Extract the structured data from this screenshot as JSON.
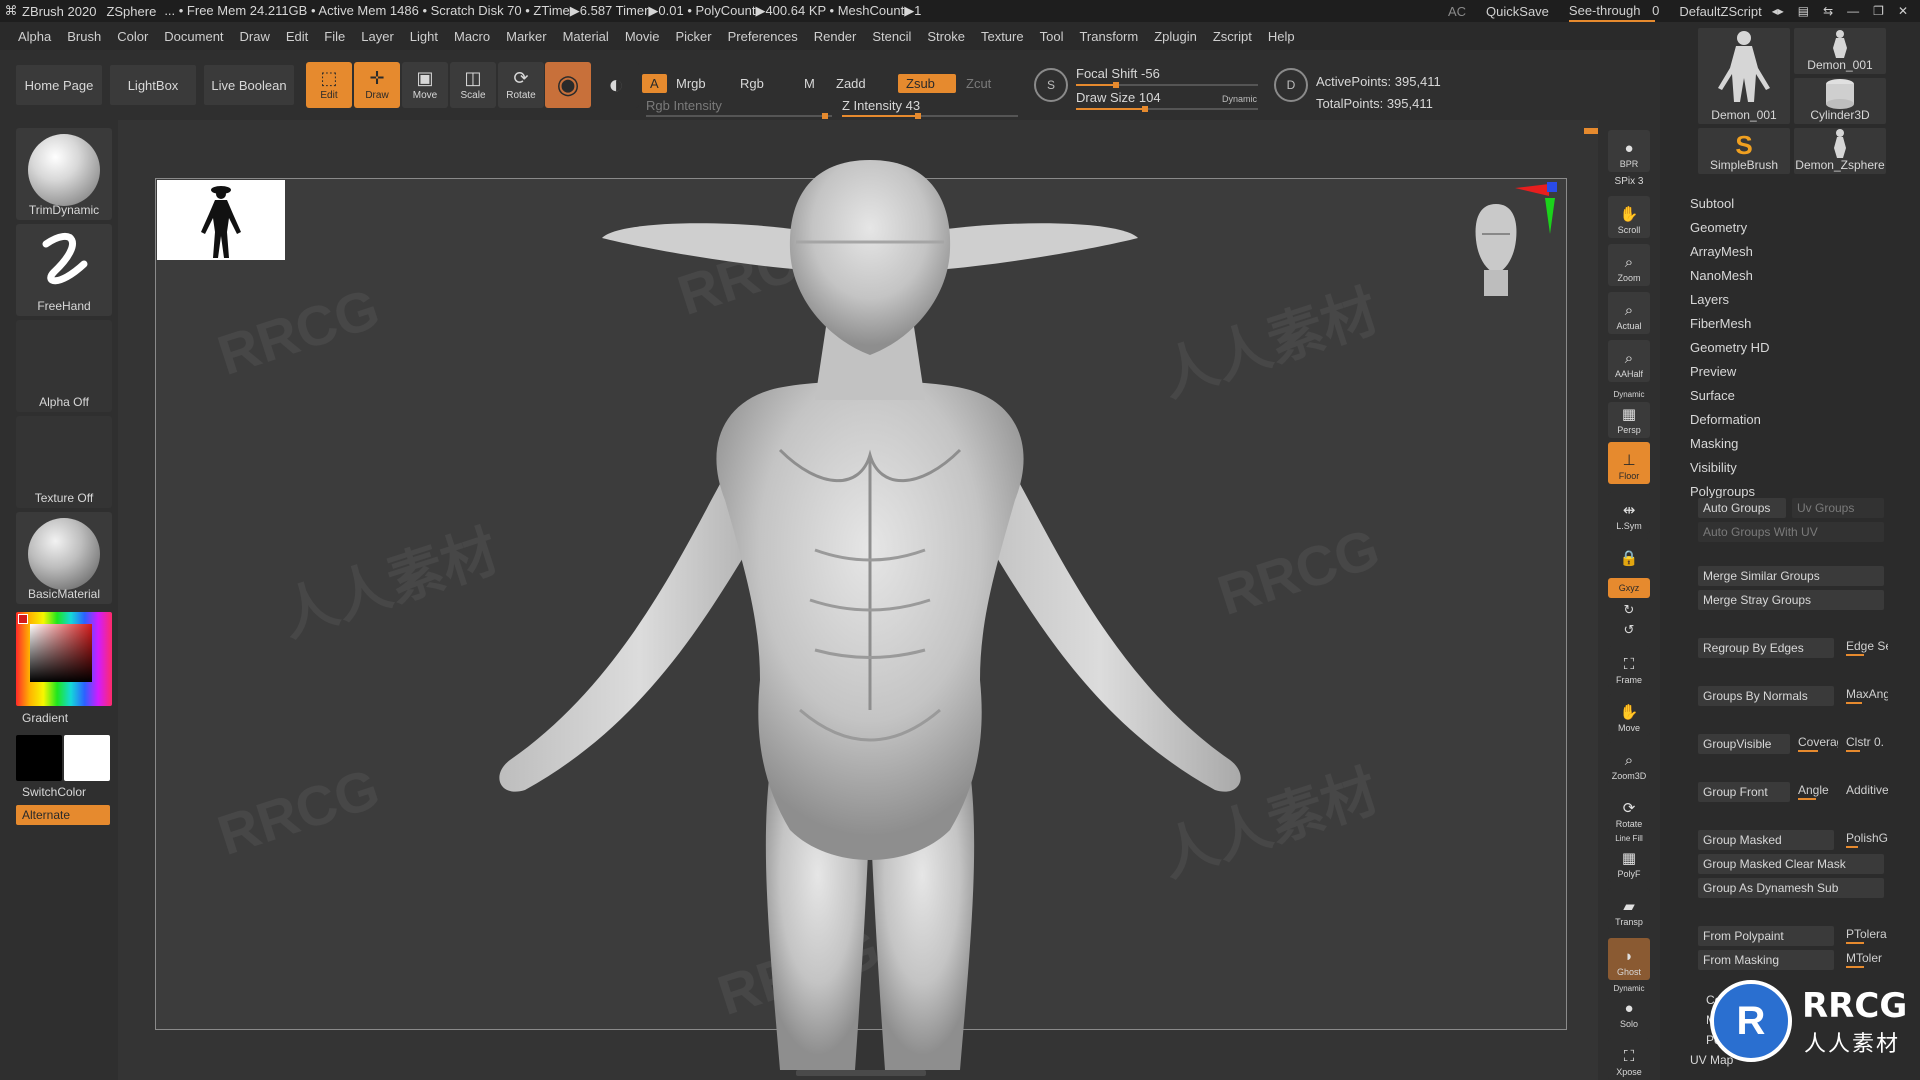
{
  "titlebar": {
    "app_title": "ZBrush 2020",
    "document": "ZSphere",
    "stats": "... • Free Mem 24.211GB • Active Mem 1486 • Scratch Disk 70 • ZTime▶6.587 Timer▶0.01 • PolyCount▶400.64 KP • MeshCount▶1",
    "ac": "AC",
    "quicksave": "QuickSave",
    "see_through_label": "See-through",
    "see_through_value": "0",
    "default_script": "DefaultZScript"
  },
  "menubar": {
    "items": [
      "Alpha",
      "Brush",
      "Color",
      "Document",
      "Draw",
      "Edit",
      "File",
      "Layer",
      "Light",
      "Macro",
      "Marker",
      "Material",
      "Movie",
      "Picker",
      "Preferences",
      "Render",
      "Stencil",
      "Stroke",
      "Texture",
      "Tool",
      "Transform",
      "Zplugin",
      "Zscript",
      "Help"
    ]
  },
  "toolbar": {
    "home_page": "Home Page",
    "lightbox": "LightBox",
    "live_boolean": "Live Boolean",
    "edit": "Edit",
    "draw": "Draw",
    "move": "Move",
    "scale": "Scale",
    "rotate": "Rotate",
    "a_label": "A",
    "mrgb": "Mrgb",
    "rgb": "Rgb",
    "m": "M",
    "rgb_intensity": "Rgb Intensity",
    "zadd": "Zadd",
    "zsub": "Zsub",
    "zcut": "Zcut",
    "z_intensity_label": "Z Intensity",
    "z_intensity_value": "43",
    "focal_shift_label": "Focal Shift",
    "focal_shift_value": "-56",
    "draw_size_label": "Draw Size",
    "draw_size_value": "104",
    "dynamic": "Dynamic",
    "active_points": "ActivePoints: 395,411",
    "total_points": "TotalPoints: 395,411",
    "z_intensity_fraction": 0.43,
    "focal_shift_fraction": 0.22,
    "draw_size_fraction": 0.38
  },
  "left_shelf": {
    "brush": "TrimDynamic",
    "stroke": "FreeHand",
    "alpha": "Alpha Off",
    "texture": "Texture Off",
    "material": "BasicMaterial",
    "gradient": "Gradient",
    "switch_color": "SwitchColor",
    "alternate": "Alternate"
  },
  "right_shelf": {
    "bpr": "BPR",
    "spix": "SPix 3",
    "scroll": "Scroll",
    "zoom": "Zoom",
    "actual": "Actual",
    "aahalf": "AAHalf",
    "dynamic": "Dynamic",
    "persp": "Persp",
    "floor": "Floor",
    "lsym": "L.Sym",
    "xyz": "Gxyz",
    "frame": "Frame",
    "move": "Move",
    "zoom3d": "Zoom3D",
    "rotate": "Rotate",
    "line_fill": "Line Fill",
    "polyf": "PolyF",
    "transp": "Transp",
    "ghost": "Ghost",
    "dynamic2": "Dynamic",
    "solo": "Solo",
    "xpose": "Xpose"
  },
  "palette": {
    "tools": [
      "Demon_001",
      "Demon_001",
      "Cylinder3D",
      "SimpleBrush",
      "Demon_Zsphere"
    ],
    "menu": [
      "Subtool",
      "Geometry",
      "ArrayMesh",
      "NanoMesh",
      "Layers",
      "FiberMesh",
      "Geometry HD",
      "Preview",
      "Surface",
      "Deformation",
      "Masking",
      "Visibility",
      "Polygroups"
    ],
    "auto_groups": "Auto Groups",
    "uv_groups": "Uv Groups",
    "auto_groups_uv": "Auto Groups With UV",
    "merge_similar": "Merge Similar Groups",
    "merge_stray": "Merge Stray Groups",
    "regroup_edges": "Regroup By Edges",
    "edge_se": "Edge Se",
    "groups_normals": "Groups By Normals",
    "maxang": "MaxAng",
    "group_visible": "GroupVisible",
    "coverage": "Coverag",
    "clstr": "Clstr 0.",
    "group_front": "Group Front",
    "angle": "Angle",
    "additive": "Additive",
    "group_masked": "Group Masked",
    "polish": "PolishG",
    "group_masked_clear": "Group Masked Clear Mask",
    "group_dynamesh": "Group As Dynamesh Sub",
    "from_polypaint": "From Polypaint",
    "ptolera": "PTolera",
    "from_masking": "From Masking",
    "mtolera": "MToler",
    "bottom_items": [
      "Co",
      "M",
      "Poly",
      "UV Map"
    ]
  },
  "watermark": {
    "brand": "RRCG",
    "cn": "人人素材",
    "logo_text": "RRCG",
    "logo_sub": "人人素材"
  },
  "colors": {
    "accent": "#e68a2e",
    "bg": "#2b2b2b",
    "mesh": "#cfcfcf"
  }
}
